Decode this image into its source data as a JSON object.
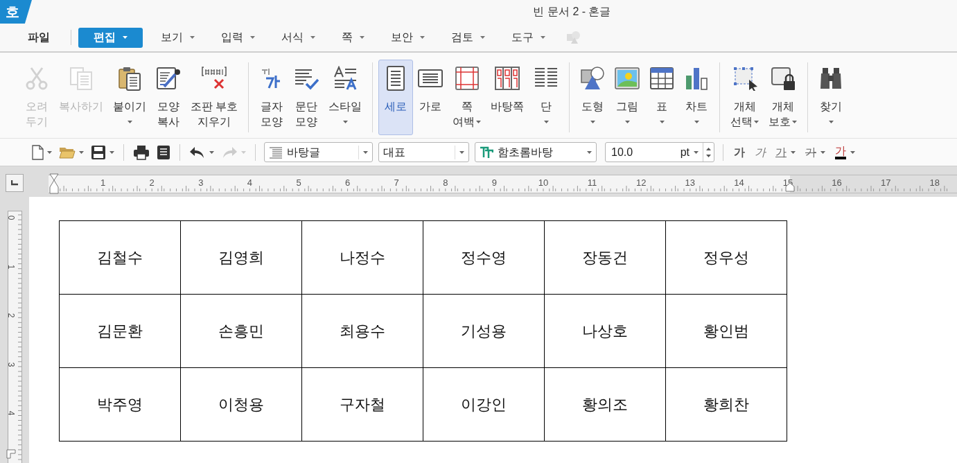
{
  "window": {
    "app_icon": "호",
    "title": "빈 문서 2 - 혼글"
  },
  "menu": [
    {
      "label": "파일",
      "caret": false,
      "selected": false
    },
    {
      "label": "편집",
      "caret": true,
      "selected": true
    },
    {
      "label": "보기",
      "caret": true,
      "selected": false
    },
    {
      "label": "입력",
      "caret": true,
      "selected": false
    },
    {
      "label": "서식",
      "caret": true,
      "selected": false
    },
    {
      "label": "쪽",
      "caret": true,
      "selected": false
    },
    {
      "label": "보안",
      "caret": true,
      "selected": false
    },
    {
      "label": "검토",
      "caret": true,
      "selected": false
    },
    {
      "label": "도구",
      "caret": true,
      "selected": false
    }
  ],
  "ribbon": [
    [
      {
        "lines": [
          "오려",
          "두기"
        ],
        "disabled": true,
        "selected": false,
        "caret": false
      },
      {
        "lines": [
          "복사하기"
        ],
        "disabled": true,
        "selected": false,
        "caret": false
      },
      {
        "lines": [
          "붙이기"
        ],
        "disabled": false,
        "selected": false,
        "caret": true
      },
      {
        "lines": [
          "모양",
          "복사"
        ],
        "disabled": false,
        "selected": false,
        "caret": false
      },
      {
        "lines": [
          "조판 부호",
          "지우기"
        ],
        "disabled": false,
        "selected": false,
        "caret": false
      }
    ],
    [
      {
        "lines": [
          "글자",
          "모양"
        ],
        "disabled": false,
        "selected": false,
        "caret": false
      },
      {
        "lines": [
          "문단",
          "모양"
        ],
        "disabled": false,
        "selected": false,
        "caret": false
      },
      {
        "lines": [
          "스타일"
        ],
        "disabled": false,
        "selected": false,
        "caret": true
      }
    ],
    [
      {
        "lines": [
          "세로"
        ],
        "disabled": false,
        "selected": true,
        "caret": false
      },
      {
        "lines": [
          "가로"
        ],
        "disabled": false,
        "selected": false,
        "caret": false
      },
      {
        "lines": [
          "쪽",
          "여백"
        ],
        "disabled": false,
        "selected": false,
        "caret": true,
        "caret_inline": true
      },
      {
        "lines": [
          "바탕쪽"
        ],
        "disabled": false,
        "selected": false,
        "caret": false
      },
      {
        "lines": [
          "단"
        ],
        "disabled": false,
        "selected": false,
        "caret": true
      }
    ],
    [
      {
        "lines": [
          "도형"
        ],
        "disabled": false,
        "selected": false,
        "caret": true
      },
      {
        "lines": [
          "그림"
        ],
        "disabled": false,
        "selected": false,
        "caret": true
      },
      {
        "lines": [
          "표"
        ],
        "disabled": false,
        "selected": false,
        "caret": true
      },
      {
        "lines": [
          "차트"
        ],
        "disabled": false,
        "selected": false,
        "caret": true
      }
    ],
    [
      {
        "lines": [
          "개체",
          "선택"
        ],
        "disabled": false,
        "selected": false,
        "caret": true,
        "caret_inline": true
      },
      {
        "lines": [
          "개체",
          "보호"
        ],
        "disabled": false,
        "selected": false,
        "caret": true,
        "caret_inline": true
      }
    ],
    [
      {
        "lines": [
          "찾기"
        ],
        "disabled": false,
        "selected": false,
        "caret": true
      }
    ]
  ],
  "toolbar": {
    "style": "바탕글",
    "numbering": "대표",
    "font": "함초롬바탕",
    "font_size": "10.0",
    "unit": "pt",
    "format_buttons": [
      {
        "glyph": "가",
        "caret": false
      },
      {
        "glyph": "가",
        "caret": false
      },
      {
        "glyph": "가",
        "caret": true
      },
      {
        "glyph": "가",
        "caret": true
      },
      {
        "glyph": "가",
        "caret": true
      }
    ]
  },
  "ruler": {
    "horizontal": [
      "1",
      "2",
      "3",
      "4",
      "5",
      "6",
      "7",
      "8",
      "9",
      "10",
      "11",
      "12",
      "13",
      "14",
      "15",
      "16",
      "17",
      "18"
    ],
    "vertical": [
      "0",
      "1",
      "2",
      "3",
      "4"
    ]
  },
  "table": {
    "rows": [
      [
        "김철수",
        "김영희",
        "나정수",
        "정수영",
        "장동건",
        "정우성"
      ],
      [
        "김문환",
        "손흥민",
        "최용수",
        "기성용",
        "나상호",
        "황인범"
      ],
      [
        "박주영",
        "이청용",
        "구자철",
        "이강인",
        "황의조",
        "황희찬"
      ]
    ]
  }
}
